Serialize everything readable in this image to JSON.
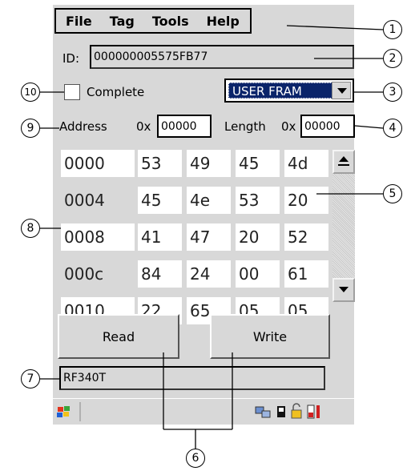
{
  "menu": {
    "file": "File",
    "tag": "Tag",
    "tools": "Tools",
    "help": "Help"
  },
  "id_label": "ID:",
  "id_value": "000000005575FB77",
  "complete_label": "Complete",
  "memory_select": {
    "selected": "USER FRAM"
  },
  "address": {
    "label": "Address",
    "prefix": "0x",
    "value": "00000"
  },
  "length": {
    "label": "Length",
    "prefix": "0x",
    "value": "00000"
  },
  "rows": [
    {
      "addr": "0000",
      "b": [
        "53",
        "49",
        "45",
        "4d"
      ]
    },
    {
      "addr": "0004",
      "b": [
        "45",
        "4e",
        "53",
        "20"
      ]
    },
    {
      "addr": "0008",
      "b": [
        "41",
        "47",
        "20",
        "52"
      ]
    },
    {
      "addr": "000c",
      "b": [
        "84",
        "24",
        "00",
        "61"
      ]
    },
    {
      "addr": "0010",
      "b": [
        "22",
        "65",
        "05",
        "05"
      ]
    }
  ],
  "read_label": "Read",
  "write_label": "Write",
  "reader_status": "RF340T",
  "callouts": [
    "1",
    "2",
    "3",
    "4",
    "5",
    "6",
    "7",
    "8",
    "9",
    "10"
  ],
  "colors": {
    "window": "#d8d8d8",
    "selection": "#0a246a"
  }
}
